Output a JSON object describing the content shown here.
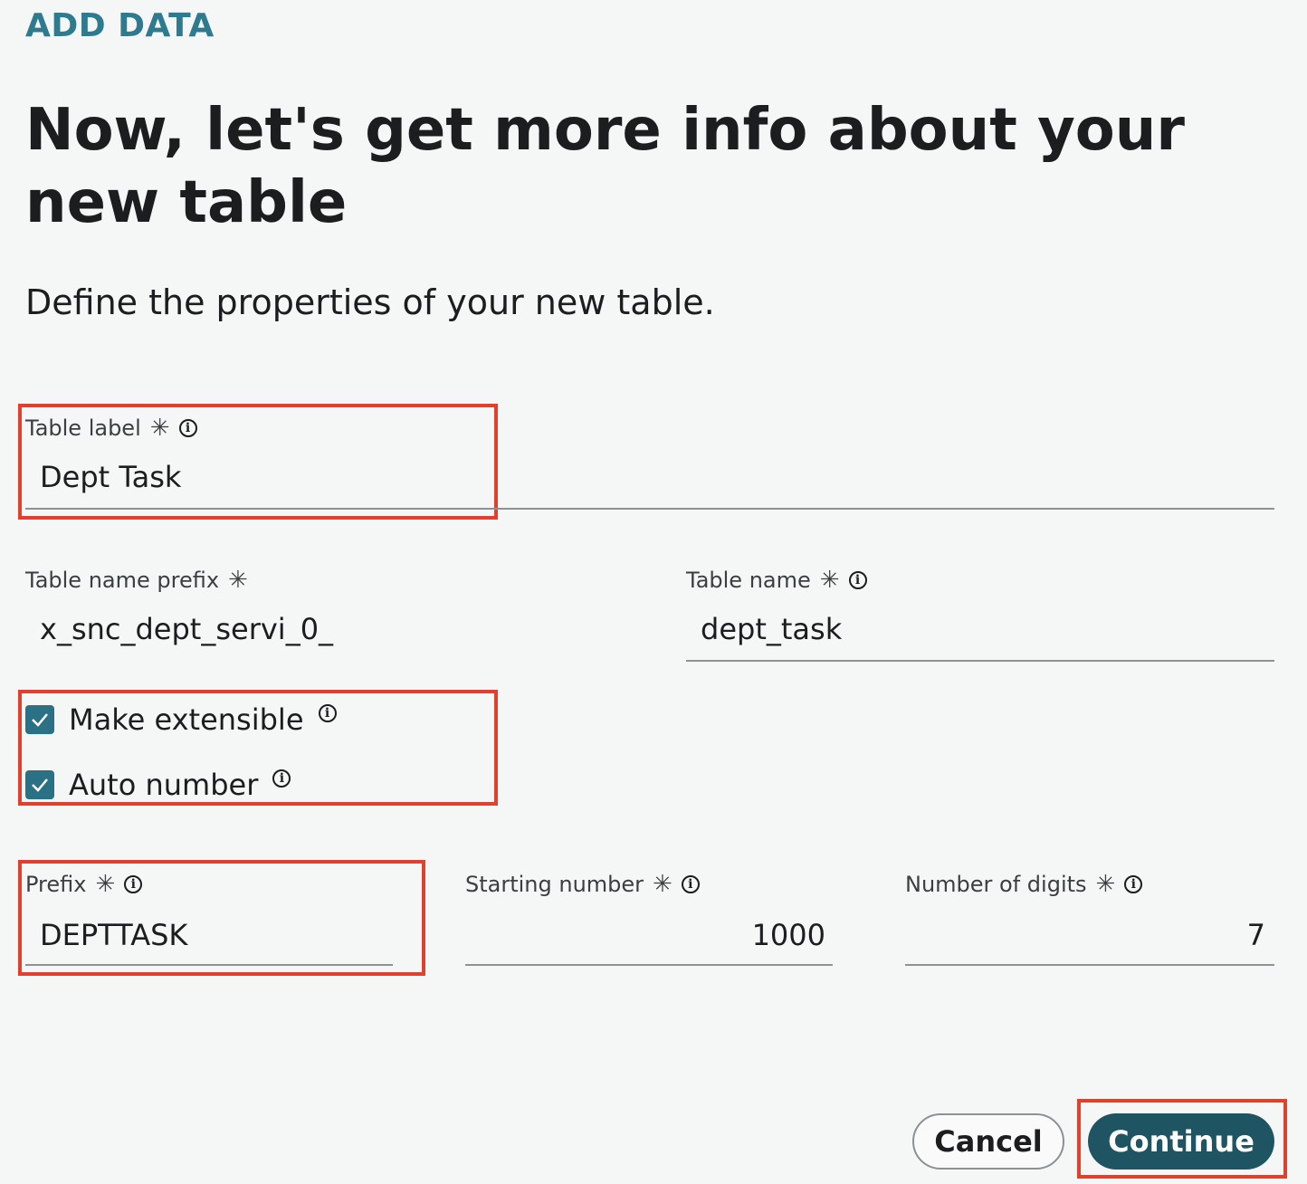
{
  "header": {
    "eyebrow": "ADD DATA",
    "title": "Now, let's get more info about your new table",
    "subtitle": "Define the properties of your new table."
  },
  "fields": {
    "table_label": {
      "label": "Table label",
      "required": "✳",
      "info_icon": "info-icon",
      "value": "Dept Task"
    },
    "table_name_prefix": {
      "label": "Table name prefix",
      "required": "✳",
      "value": "x_snc_dept_servi_0_"
    },
    "table_name": {
      "label": "Table name",
      "required": "✳",
      "info_icon": "info-icon",
      "value": "dept_task"
    },
    "prefix": {
      "label": "Prefix",
      "required": "✳",
      "info_icon": "info-icon",
      "value": "DEPTTASK"
    },
    "starting_number": {
      "label": "Starting number",
      "required": "✳",
      "info_icon": "info-icon",
      "value": "1000"
    },
    "number_of_digits": {
      "label": "Number of digits",
      "required": "✳",
      "info_icon": "info-icon",
      "value": "7"
    }
  },
  "checkboxes": {
    "make_extensible": {
      "label": "Make extensible",
      "checked": true
    },
    "auto_number": {
      "label": "Auto number",
      "checked": true
    }
  },
  "actions": {
    "cancel_label": "Cancel",
    "continue_label": "Continue"
  },
  "colors": {
    "accent": "#2e7a8e",
    "checkbox": "#2b7186",
    "primary_button": "#1f5462",
    "highlight": "#e0402c"
  }
}
